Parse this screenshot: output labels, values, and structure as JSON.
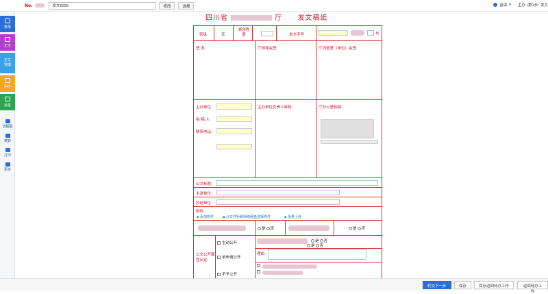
{
  "topbar": {
    "no_label": "No.",
    "no_value": "发文2025-",
    "edit_label": "修改",
    "select_label": "选择",
    "voice_label": "音读",
    "user_label": "主办 (第1步: 发文"
  },
  "sidebar": {
    "items": [
      {
        "label": "表单",
        "color": "#2a6fd6"
      },
      {
        "label": "正文",
        "color": "#b23fc8"
      },
      {
        "label": "正文管理",
        "color": "#3aa1e8"
      },
      {
        "label": "附件",
        "color": "#f5a623"
      },
      {
        "label": "会签",
        "color": "#2da44e"
      }
    ],
    "tools": [
      "流程图",
      "表转",
      "打印",
      "更多"
    ]
  },
  "doc": {
    "title_left": "四川省",
    "title_right": "厅",
    "title_suffix": "发文稿纸",
    "secret_label": "密级",
    "secret_value": "无",
    "urgency_label": "紧急程度",
    "doc_no_label": "发文字号",
    "doc_no_unit": "号",
    "sign_label": "签 发:",
    "leader_label": "厅领导会签:",
    "dept_label": "厅内处室（单位）会签:",
    "host_unit_label": "主办单位:",
    "drafter_label": "拟 稿 人:",
    "phone_label": "联系电话:",
    "host_leader_label": "主办单位负责人审核:",
    "office_label": "厅办公室核稿:",
    "subject_label": "公文标题:",
    "main_send_label": "主送单位:",
    "copy_send_label": "抄送单位:",
    "attach_label": "附件:",
    "attach_links": [
      "添加附件",
      "从文件柜和网络硬盘选择附件",
      "批量上传"
    ],
    "yes": "是",
    "no": "否",
    "public_attr_label": "公文公开属性认定",
    "active_public": "主动公开",
    "apply_public": "依申请公开",
    "reason_label": "理由:",
    "not_public": "不予公开"
  },
  "bottombar": {
    "submit_label": "转交下一步",
    "save_label": "保存",
    "save_return_label": "保存返回待办工作",
    "return_label": "返回待办工作"
  },
  "colors": {
    "accent": "#2a6fd6",
    "doc_red": "#c8102e"
  }
}
